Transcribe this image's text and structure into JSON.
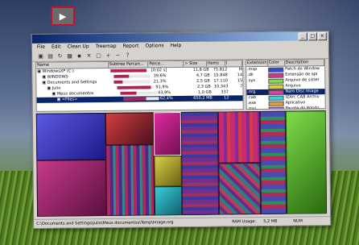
{
  "menu": [
    "File",
    "Edit",
    "Clean Up",
    "Treemap",
    "Report",
    "Options",
    "Help"
  ],
  "dir_headers": [
    "Name",
    "Subtree Percen...",
    "Perce...",
    "> Size",
    "Items",
    "I"
  ],
  "dir_rows": [
    {
      "name": "WindowsXP (C:)",
      "subtree": "",
      "perc": "[0:02 s]",
      "size": "11,8 GB",
      "items": "75.812",
      "extra": "M",
      "fill": 100,
      "selected": false
    },
    {
      "name": "WINDOWS",
      "subtree": "",
      "perc": "39,6%",
      "size": "4,7 GB",
      "items": "15.848",
      "extra": "14",
      "fill": 40,
      "selected": false
    },
    {
      "name": "Documents and Settings",
      "subtree": "",
      "perc": "21,3%",
      "size": "2,5 GB",
      "items": "17.110",
      "extra": "15",
      "fill": 21,
      "selected": false
    },
    {
      "name": "Julio",
      "subtree": "",
      "perc": "91,9%",
      "size": "2,3 GB",
      "items": "10.343",
      "extra": "7",
      "fill": 92,
      "selected": false
    },
    {
      "name": "Meus documentos",
      "subtree": "",
      "perc": "43,9%",
      "size": "1,0 GB",
      "items": "337",
      "extra": "",
      "fill": 44,
      "selected": false
    },
    {
      "name": "<Files>",
      "subtree": "",
      "perc": "62,4%",
      "size": "650,2 MB",
      "items": "12",
      "extra": "",
      "fill": 62,
      "selected": true
    }
  ],
  "ext_headers": [
    "Extension",
    "Color",
    "Description"
  ],
  "ext_rows": [
    {
      "ext": ".msp",
      "color": "#2c4bd6",
      "desc": "Patch do Window"
    },
    {
      "ext": ".dll",
      "color": "#c83a8a",
      "desc": "Extensão de apl"
    },
    {
      "ext": ".sys",
      "color": "#7fdc4a",
      "desc": "Arquivo de sister"
    },
    {
      "ext": "",
      "color": "#d8d04a",
      "desc": "Arquivo"
    },
    {
      "ext": ".nrg",
      "color": "#e23ea6",
      "desc": "Nero Disc Image"
    },
    {
      "ext": ".cab",
      "color": "#3acfd8",
      "desc": "IZArc CAB Archiv"
    },
    {
      "ext": ".exe",
      "color": "#e0a040",
      "desc": "Aplicativo"
    },
    {
      "ext": ".msi",
      "color": "#9a64d0",
      "desc": "Pacote do Windo"
    }
  ],
  "status": {
    "path": "C:\\Documents and Settings\\Julio\\Meus documentos\\Temp\\Image.nrg",
    "ram_label": "RAM Usage:",
    "ram_value": "5,2 MB",
    "num": "NUM"
  },
  "colors": {
    "selection": "#0a246a",
    "titlebar": "#0a246a"
  }
}
